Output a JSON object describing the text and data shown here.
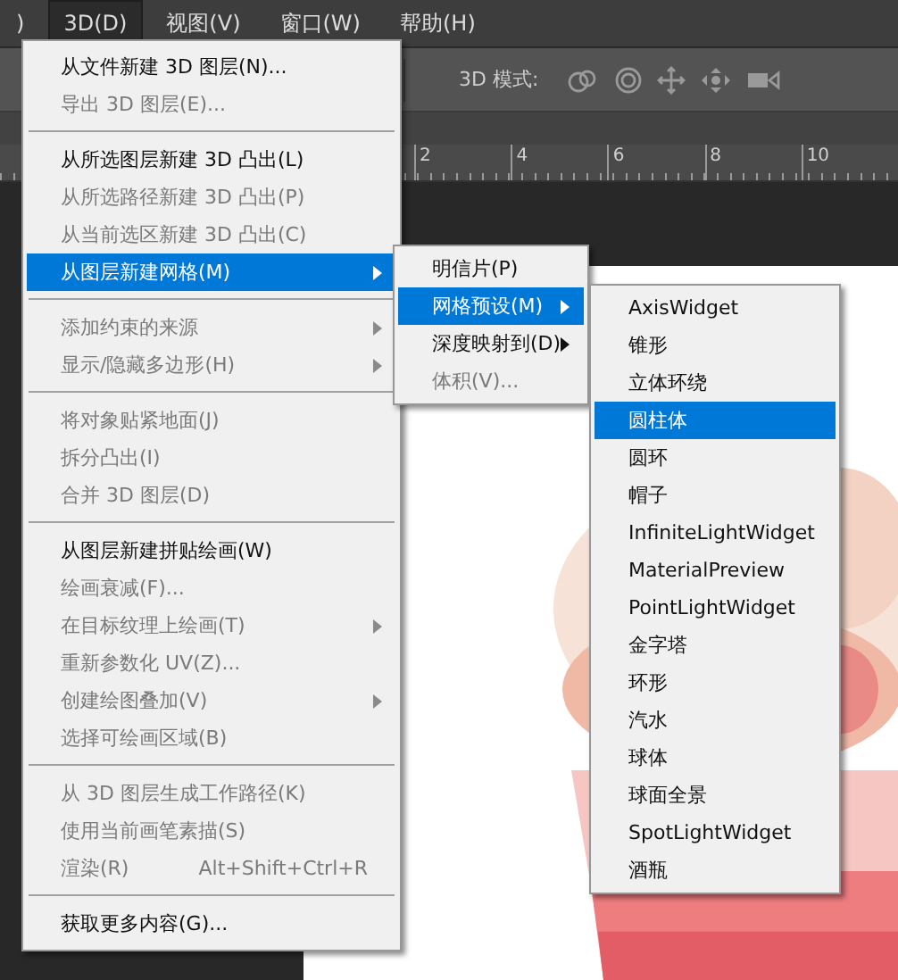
{
  "menubar": [
    {
      "label": ")",
      "selected": false
    },
    {
      "label": "3D(D)",
      "selected": true
    },
    {
      "label": "视图(V)",
      "selected": false
    },
    {
      "label": "窗口(W)",
      "selected": false
    },
    {
      "label": "帮助(H)",
      "selected": false
    }
  ],
  "toolbar": {
    "mode_label": "3D 模式:"
  },
  "ruler": [
    "2",
    "4",
    "6",
    "8",
    "10"
  ],
  "menu": [
    {
      "kind": "item",
      "label": "从文件新建 3D 图层(N)...",
      "disabled": false,
      "selected": false,
      "submenu": false
    },
    {
      "kind": "item",
      "label": "导出 3D 图层(E)...",
      "disabled": true,
      "selected": false,
      "submenu": false
    },
    {
      "kind": "separator"
    },
    {
      "kind": "item",
      "label": "从所选图层新建 3D 凸出(L)",
      "disabled": false,
      "selected": false,
      "submenu": false
    },
    {
      "kind": "item",
      "label": "从所选路径新建 3D 凸出(P)",
      "disabled": true,
      "selected": false,
      "submenu": false
    },
    {
      "kind": "item",
      "label": "从当前选区新建 3D 凸出(C)",
      "disabled": true,
      "selected": false,
      "submenu": false
    },
    {
      "kind": "item",
      "label": "从图层新建网格(M)",
      "disabled": false,
      "selected": true,
      "submenu": true
    },
    {
      "kind": "separator"
    },
    {
      "kind": "item",
      "label": "添加约束的来源",
      "disabled": true,
      "selected": false,
      "submenu": true
    },
    {
      "kind": "item",
      "label": "显示/隐藏多边形(H)",
      "disabled": true,
      "selected": false,
      "submenu": true
    },
    {
      "kind": "separator"
    },
    {
      "kind": "item",
      "label": "将对象贴紧地面(J)",
      "disabled": true,
      "selected": false,
      "submenu": false
    },
    {
      "kind": "item",
      "label": "拆分凸出(I)",
      "disabled": true,
      "selected": false,
      "submenu": false
    },
    {
      "kind": "item",
      "label": "合并 3D 图层(D)",
      "disabled": true,
      "selected": false,
      "submenu": false
    },
    {
      "kind": "separator"
    },
    {
      "kind": "item",
      "label": "从图层新建拼贴绘画(W)",
      "disabled": false,
      "selected": false,
      "submenu": false
    },
    {
      "kind": "item",
      "label": "绘画衰减(F)...",
      "disabled": true,
      "selected": false,
      "submenu": false
    },
    {
      "kind": "item",
      "label": "在目标纹理上绘画(T)",
      "disabled": true,
      "selected": false,
      "submenu": true
    },
    {
      "kind": "item",
      "label": "重新参数化 UV(Z)...",
      "disabled": true,
      "selected": false,
      "submenu": false
    },
    {
      "kind": "item",
      "label": "创建绘图叠加(V)",
      "disabled": true,
      "selected": false,
      "submenu": true
    },
    {
      "kind": "item",
      "label": "选择可绘画区域(B)",
      "disabled": true,
      "selected": false,
      "submenu": false
    },
    {
      "kind": "separator"
    },
    {
      "kind": "item",
      "label": "从 3D 图层生成工作路径(K)",
      "disabled": true,
      "selected": false,
      "submenu": false
    },
    {
      "kind": "item",
      "label": "使用当前画笔素描(S)",
      "disabled": true,
      "selected": false,
      "submenu": false
    },
    {
      "kind": "item",
      "label": "渲染(R)",
      "shortcut": "Alt+Shift+Ctrl+R",
      "disabled": true,
      "selected": false,
      "submenu": false
    },
    {
      "kind": "separator"
    },
    {
      "kind": "item",
      "label": "获取更多内容(G)...",
      "disabled": false,
      "selected": false,
      "submenu": false
    }
  ],
  "submenu": [
    {
      "kind": "item",
      "label": "明信片(P)",
      "disabled": false,
      "selected": false,
      "submenu": false
    },
    {
      "kind": "item",
      "label": "网格预设(M)",
      "disabled": false,
      "selected": true,
      "submenu": true
    },
    {
      "kind": "item",
      "label": "深度映射到(D)",
      "disabled": false,
      "selected": false,
      "submenu": true
    },
    {
      "kind": "item",
      "label": "体积(V)...",
      "disabled": true,
      "selected": false,
      "submenu": false
    }
  ],
  "presets": [
    {
      "kind": "item",
      "label": "AxisWidget",
      "disabled": false,
      "selected": false,
      "submenu": false
    },
    {
      "kind": "item",
      "label": "锥形",
      "disabled": false,
      "selected": false,
      "submenu": false
    },
    {
      "kind": "item",
      "label": "立体环绕",
      "disabled": false,
      "selected": false,
      "submenu": false
    },
    {
      "kind": "item",
      "label": "圆柱体",
      "disabled": false,
      "selected": true,
      "submenu": false
    },
    {
      "kind": "item",
      "label": "圆环",
      "disabled": false,
      "selected": false,
      "submenu": false
    },
    {
      "kind": "item",
      "label": "帽子",
      "disabled": false,
      "selected": false,
      "submenu": false
    },
    {
      "kind": "item",
      "label": "InfiniteLightWidget",
      "disabled": false,
      "selected": false,
      "submenu": false
    },
    {
      "kind": "item",
      "label": "MaterialPreview",
      "disabled": false,
      "selected": false,
      "submenu": false
    },
    {
      "kind": "item",
      "label": "PointLightWidget",
      "disabled": false,
      "selected": false,
      "submenu": false
    },
    {
      "kind": "item",
      "label": "金字塔",
      "disabled": false,
      "selected": false,
      "submenu": false
    },
    {
      "kind": "item",
      "label": "环形",
      "disabled": false,
      "selected": false,
      "submenu": false
    },
    {
      "kind": "item",
      "label": "汽水",
      "disabled": false,
      "selected": false,
      "submenu": false
    },
    {
      "kind": "item",
      "label": "球体",
      "disabled": false,
      "selected": false,
      "submenu": false
    },
    {
      "kind": "item",
      "label": "球面全景",
      "disabled": false,
      "selected": false,
      "submenu": false
    },
    {
      "kind": "item",
      "label": "SpotLightWidget",
      "disabled": false,
      "selected": false,
      "submenu": false
    },
    {
      "kind": "item",
      "label": "酒瓶",
      "disabled": false,
      "selected": false,
      "submenu": false
    }
  ]
}
